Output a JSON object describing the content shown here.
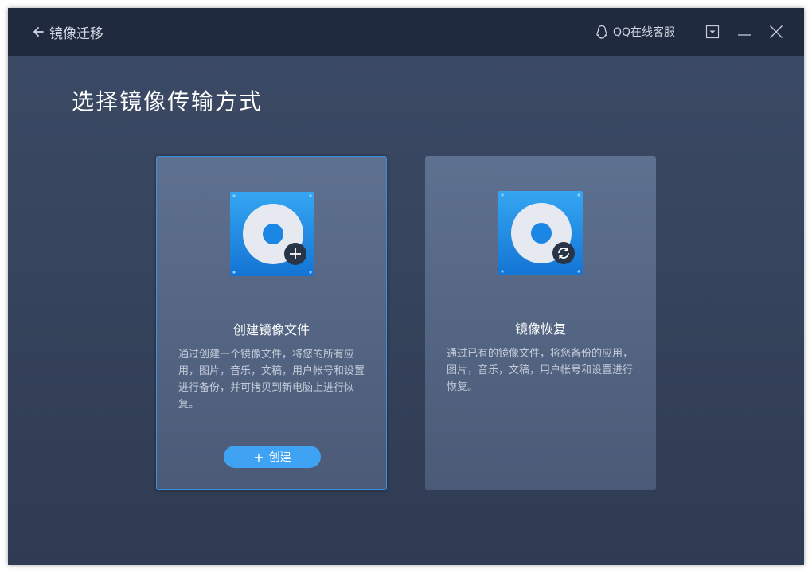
{
  "titlebar": {
    "back_label": "镜像迁移",
    "support_label": "QQ在线客服"
  },
  "main": {
    "heading": "选择镜像传输方式"
  },
  "cards": [
    {
      "title": "创建镜像文件",
      "description": "通过创建一个镜像文件，将您的所有应用，图片，音乐，文稿，用户帐号和设置进行备份，并可拷贝到新电脑上进行恢复。",
      "button_label": "创建",
      "selected": true,
      "badge_icon": "plus-icon"
    },
    {
      "title": "镜像恢复",
      "description": "通过已有的镜像文件，将您备份的应用，图片，音乐，文稿，用户帐号和设置进行恢复。",
      "selected": false,
      "badge_icon": "refresh-icon"
    }
  ],
  "colors": {
    "titlebar": "#1f2a3f",
    "accent": "#3fa2f3",
    "selected_border": "#3d8fe0"
  }
}
